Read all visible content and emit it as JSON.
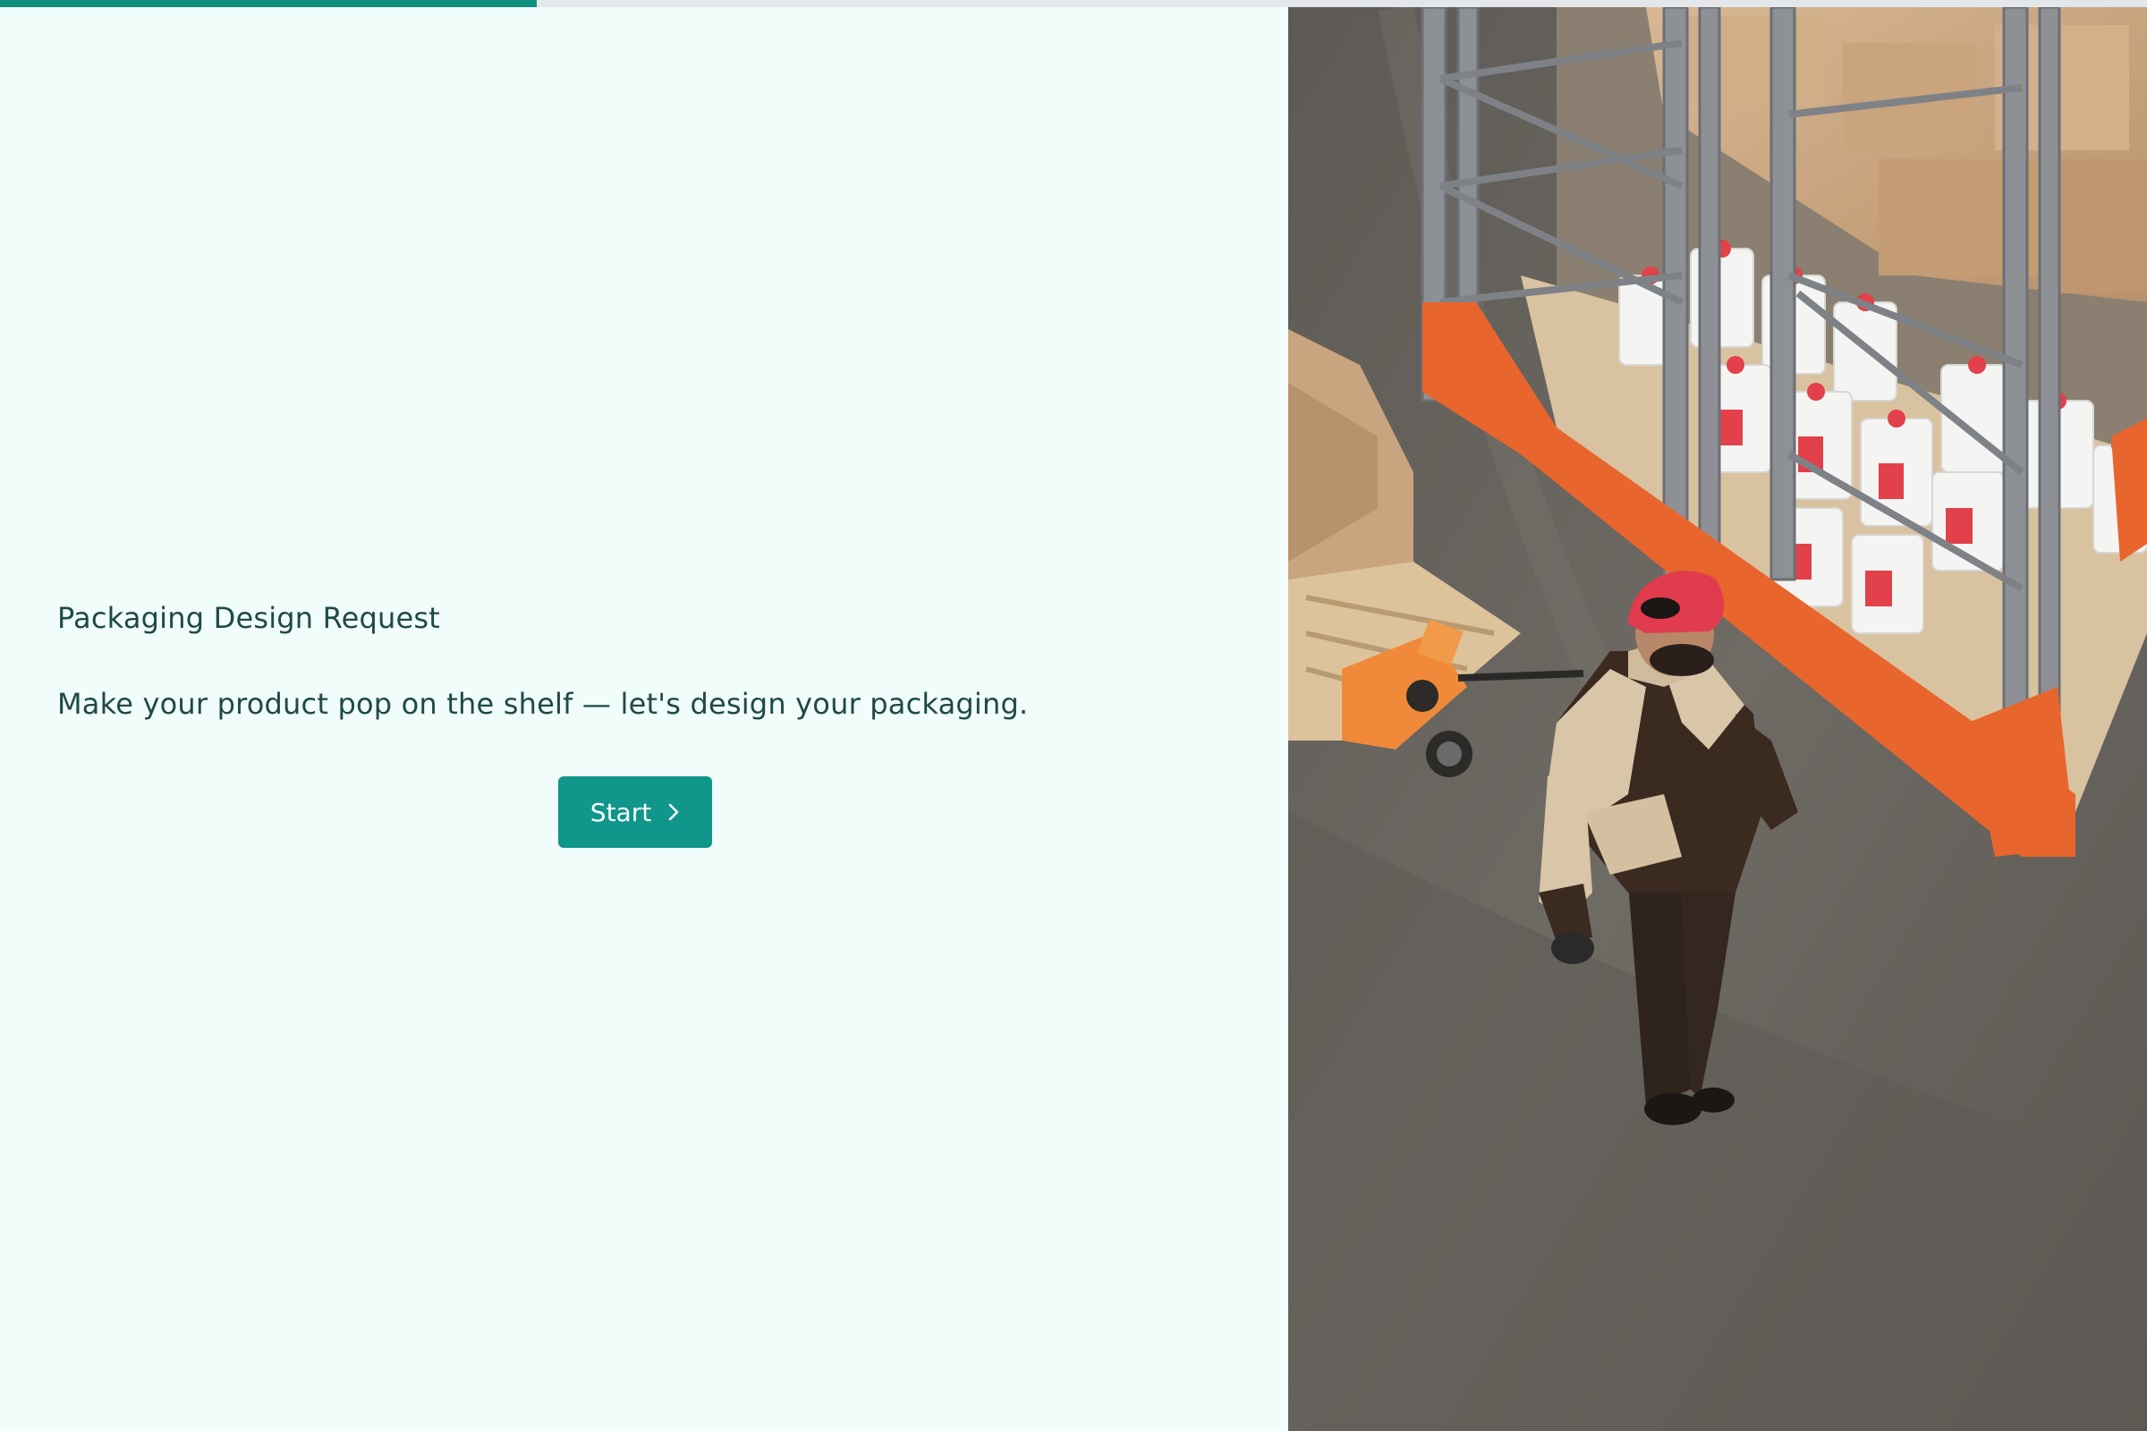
{
  "progress": {
    "fraction": 0.25,
    "color": "#0f8f7e",
    "track_color": "#e4e7ea"
  },
  "form": {
    "title": "Packaging Design Request",
    "description": "Make your product pop on the shelf — let's design your packaging.",
    "start_label": "Start",
    "start_icon": "chevron-right-icon",
    "accent_color": "#10968a",
    "background_color": "#f0fdfa"
  },
  "hero_image": {
    "subject": "warehouse-worker-photo"
  }
}
